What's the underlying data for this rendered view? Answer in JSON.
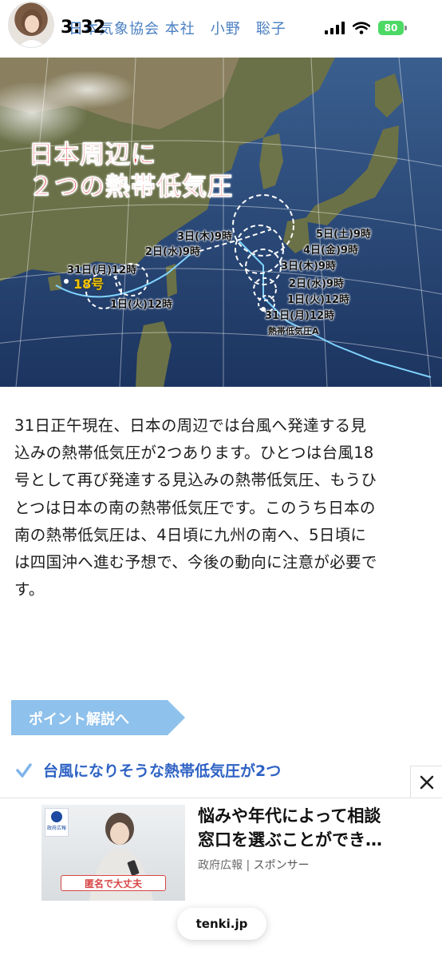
{
  "status_bar": {
    "time": "3:32",
    "battery": "80",
    "icons": [
      "signal-icon",
      "wifi-icon",
      "battery-icon"
    ]
  },
  "header": {
    "author": "日本気象協会 本社　小野　聡子"
  },
  "map": {
    "title_line1": "日本周辺に",
    "title_line2": "２つの熱帯低気圧",
    "labels": {
      "d3_thu_9": "3日(木)9時",
      "d2_wed_9_west": "2日(水)9時",
      "d31_mon_12_west": "31日(月)12時",
      "no18": "18号",
      "d1_tue_12_west": "1日(火)12時",
      "d5_sat_9": "5日(土)9時",
      "d4_fri_9": "4日(金)9時",
      "d3_thu_9_east": "3日(木)9時",
      "d2_wed_9_east": "2日(水)9時",
      "d1_tue_12_east": "1日(火)12時",
      "d31_mon_12_east": "31日(月)12時",
      "tda": "熱帯低気圧A"
    }
  },
  "article": {
    "lines": [
      "31日正午現在、日本の周辺では台風へ発達する見",
      "込みの熱帯低気圧が2つあります。ひとつは台風18",
      "号として再び発達する見込みの熱帯低気圧、もうひ",
      "とつは日本の南の熱帯低気圧です。このうち日本の",
      "南の熱帯低気圧は、4日頃に九州の南へ、5日頃に",
      "は四国沖へ進む予想で、今後の動向に注意が必要で",
      "す。"
    ]
  },
  "point": {
    "button_label": "ポイント解説へ",
    "item": "台風になりそうな熱帯低気圧が2つ"
  },
  "ad": {
    "title_line1": "悩みや年代によって相談",
    "title_line2": "窓口を選ぶことができ…",
    "sponsor_name": "政府広報",
    "sponsor_suffix": "スポンサー",
    "badge_text": "政府広報",
    "image_caption": "匿名で大丈夫"
  },
  "bottom": {
    "url": "tenki.jp"
  }
}
